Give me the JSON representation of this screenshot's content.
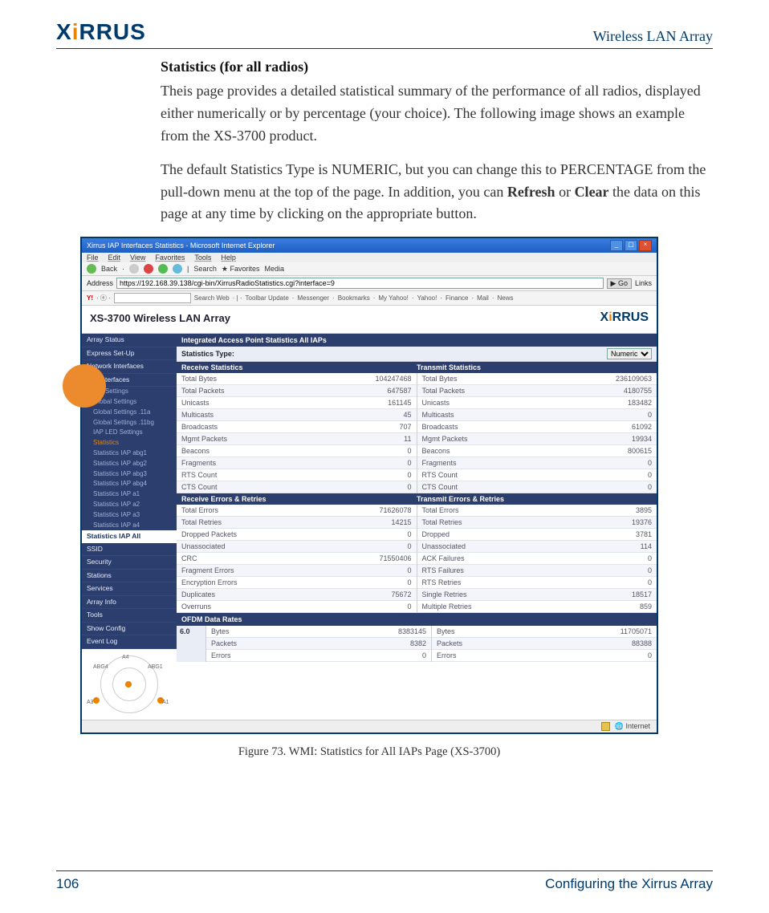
{
  "header": {
    "logo_left": "X",
    "logo_accent": "i",
    "logo_right": "RRUS",
    "header_link": "Wireless LAN Array"
  },
  "section_title": "Statistics (for all radios)",
  "para1": "Theis page provides a detailed statistical summary of the performance of all radios, displayed either numerically or by percentage (your choice). The following image shows an example from the XS-3700 product.",
  "para2_a": "The default Statistics Type is NUMERIC, but you can change this to PERCENTAGE from the pull-down menu at the top of the page. In addition, you can ",
  "para2_b": "Refresh",
  "para2_c": " or ",
  "para2_d": "Clear",
  "para2_e": " the data on this page at any time by clicking on the appropriate button.",
  "browser": {
    "title": "Xirrus IAP Interfaces Statistics - Microsoft Internet Explorer",
    "menu": [
      "File",
      "Edit",
      "View",
      "Favorites",
      "Tools",
      "Help"
    ],
    "toolbar": {
      "back": "Back",
      "search": "Search",
      "favorites": "Favorites",
      "media": "Media"
    },
    "address_label": "Address",
    "address_value": "https://192.168.39.138/cgi-bin/XirrusRadioStatistics.cgi?interface=9",
    "go": "Go",
    "links": "Links",
    "yahoo": {
      "logo": "Y!",
      "search_btn": "Search Web",
      "items": [
        "Toolbar Update",
        "Messenger",
        "Bookmarks",
        "My Yahoo!",
        "Yahoo!",
        "Finance",
        "Mail",
        "News"
      ]
    }
  },
  "app": {
    "title": "XS-3700 Wireless LAN Array",
    "logo_l": "X",
    "logo_a": "i",
    "logo_r": "RRUS",
    "sidebar_top": [
      "Array Status",
      "Express Set-Up",
      "Network Interfaces",
      "IAP Interfaces"
    ],
    "sidebar_iap": [
      "IAP Settings",
      "Global Settings",
      "Global Settings .11a",
      "Global Settings .11bg",
      "IAP LED Settings"
    ],
    "sidebar_stats_label": "Statistics",
    "sidebar_stats": [
      "Statistics IAP abg1",
      "Statistics IAP abg2",
      "Statistics IAP abg3",
      "Statistics IAP abg4",
      "Statistics IAP a1",
      "Statistics IAP a2",
      "Statistics IAP a3",
      "Statistics IAP a4"
    ],
    "sidebar_head": "Statistics IAP All",
    "sidebar_bottom": [
      "SSID",
      "Security",
      "Stations",
      "Services",
      "Array Info",
      "Tools",
      "Show Config",
      "Event Log"
    ],
    "radar_labels": {
      "a4": "A4",
      "abg4": "ABG4",
      "abg1": "ABG1",
      "a3": "A3",
      "a1": "A1"
    },
    "main_title": "Integrated Access Point Statistics All IAPs",
    "stats_type_label": "Statistics Type:",
    "stats_type_value": "Numeric",
    "recv_header": "Receive Statistics",
    "xmit_header": "Transmit Statistics",
    "stats_rows": [
      {
        "l": "Total Bytes",
        "lv": "104247468",
        "r": "Total Bytes",
        "rv": "236109063"
      },
      {
        "l": "Total Packets",
        "lv": "647587",
        "r": "Total Packets",
        "rv": "4180755"
      },
      {
        "l": "Unicasts",
        "lv": "161145",
        "r": "Unicasts",
        "rv": "183482"
      },
      {
        "l": "Multicasts",
        "lv": "45",
        "r": "Multicasts",
        "rv": "0"
      },
      {
        "l": "Broadcasts",
        "lv": "707",
        "r": "Broadcasts",
        "rv": "61092"
      },
      {
        "l": "Mgmt Packets",
        "lv": "11",
        "r": "Mgmt Packets",
        "rv": "19934"
      },
      {
        "l": "Beacons",
        "lv": "0",
        "r": "Beacons",
        "rv": "800615"
      },
      {
        "l": "Fragments",
        "lv": "0",
        "r": "Fragments",
        "rv": "0"
      },
      {
        "l": "RTS Count",
        "lv": "0",
        "r": "RTS Count",
        "rv": "0"
      },
      {
        "l": "CTS Count",
        "lv": "0",
        "r": "CTS Count",
        "rv": "0"
      }
    ],
    "err_recv_header": "Receive Errors & Retries",
    "err_xmit_header": "Transmit Errors & Retries",
    "err_rows": [
      {
        "l": "Total Errors",
        "lv": "71626078",
        "r": "Total Errors",
        "rv": "3895"
      },
      {
        "l": "Total Retries",
        "lv": "14215",
        "r": "Total Retries",
        "rv": "19376"
      },
      {
        "l": "Dropped Packets",
        "lv": "0",
        "r": "Dropped",
        "rv": "3781"
      },
      {
        "l": "Unassociated",
        "lv": "0",
        "r": "Unassociated",
        "rv": "114"
      },
      {
        "l": "CRC",
        "lv": "71550406",
        "r": "ACK Failures",
        "rv": "0"
      },
      {
        "l": "Fragment Errors",
        "lv": "0",
        "r": "RTS Failures",
        "rv": "0"
      },
      {
        "l": "Encryption Errors",
        "lv": "0",
        "r": "RTS Retries",
        "rv": "0"
      },
      {
        "l": "Duplicates",
        "lv": "75672",
        "r": "Single Retries",
        "rv": "18517"
      },
      {
        "l": "Overruns",
        "lv": "0",
        "r": "Multiple Retries",
        "rv": "859"
      }
    ],
    "ofdm_header": "OFDM Data Rates",
    "ofdm_rate": "6.0",
    "ofdm_rows": [
      {
        "l": "Bytes",
        "lv": "8383145",
        "r": "Bytes",
        "rv": "11705071"
      },
      {
        "l": "Packets",
        "lv": "8382",
        "r": "Packets",
        "rv": "88388"
      },
      {
        "l": "Errors",
        "lv": "0",
        "r": "Errors",
        "rv": "0"
      }
    ],
    "status": "Internet"
  },
  "caption": "Figure 73. WMI: Statistics for All IAPs Page (XS-3700)",
  "footer": {
    "page": "106",
    "section": "Configuring the Xirrus Array"
  }
}
